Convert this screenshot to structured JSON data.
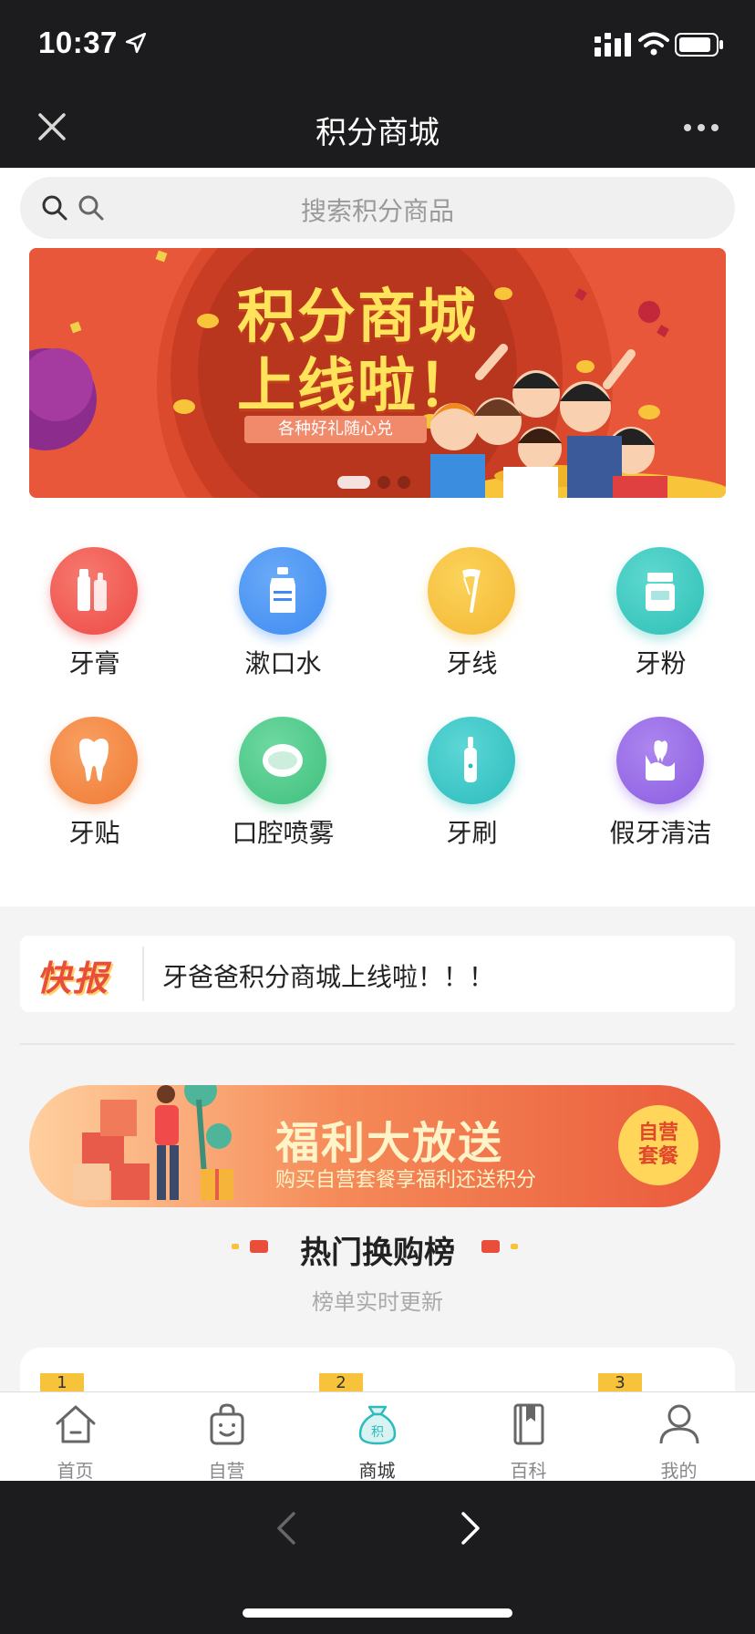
{
  "status_bar": {
    "time": "10:37"
  },
  "nav": {
    "title": "积分商城"
  },
  "search": {
    "placeholder": "搜索积分商品"
  },
  "banner": {
    "title_line1": "积分商城",
    "title_line2": "上线啦！",
    "subtitle": "各种好礼随心兑",
    "slide_count": 3,
    "active_slide": 1
  },
  "categories": [
    {
      "label": "牙膏",
      "icon": "toothpaste-icon",
      "color": "#ec4a45"
    },
    {
      "label": "漱口水",
      "icon": "mouthwash-icon",
      "color": "#3d8bf2"
    },
    {
      "label": "牙线",
      "icon": "floss-icon",
      "color": "#f4b733"
    },
    {
      "label": "牙粉",
      "icon": "tooth-powder-icon",
      "color": "#2dbfb6"
    },
    {
      "label": "牙贴",
      "icon": "tooth-icon",
      "color": "#f07a34"
    },
    {
      "label": "口腔喷雾",
      "icon": "oral-spray-icon",
      "color": "#3ec07c"
    },
    {
      "label": "牙刷",
      "icon": "toothbrush-icon",
      "color": "#2cbcbc"
    },
    {
      "label": "假牙清洁",
      "icon": "denture-clean-icon",
      "color": "#8a5ce0"
    }
  ],
  "news": {
    "tag": "快报",
    "text": "牙爸爸积分商城上线啦！！！"
  },
  "promo": {
    "title": "福利大放送",
    "subtitle": "购买自营套餐享福利还送积分",
    "badge_line1": "自营",
    "badge_line2": "套餐"
  },
  "hot": {
    "title": "热门换购榜",
    "subtitle": "榜单实时更新",
    "ranks": [
      "1",
      "2",
      "3"
    ]
  },
  "tabs": [
    {
      "label": "首页",
      "icon": "home-icon"
    },
    {
      "label": "自营",
      "icon": "shopping-bag-icon"
    },
    {
      "label": "商城",
      "icon": "points-bag-icon",
      "active": true,
      "badge": "积"
    },
    {
      "label": "百科",
      "icon": "book-icon"
    },
    {
      "label": "我的",
      "icon": "user-icon"
    }
  ],
  "colors": {
    "accent": "#e9573b",
    "tab_active": "#2cbcbc",
    "rank_badge": "#f6c33a"
  }
}
